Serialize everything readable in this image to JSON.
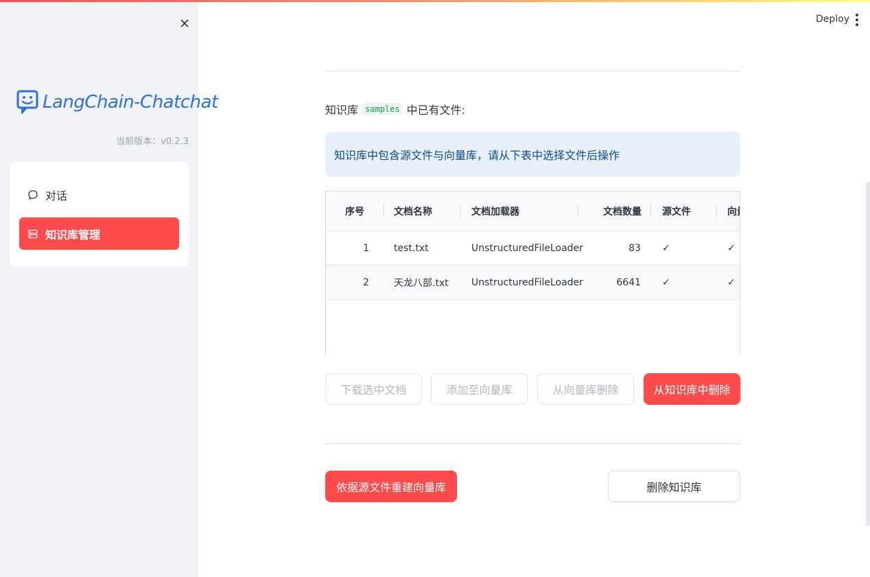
{
  "sidebar": {
    "logo_text": "LangChain-Chatchat",
    "version": "当前版本：v0.2.3",
    "nav": [
      {
        "label": "对话",
        "icon": "chat-bubble-icon",
        "active": false
      },
      {
        "label": "知识库管理",
        "icon": "database-icon",
        "active": true
      }
    ]
  },
  "header": {
    "deploy_label": "Deploy"
  },
  "main": {
    "kb_title_prefix": "知识库",
    "kb_name": "samples",
    "kb_title_suffix": "中已有文件:",
    "info_message": "知识库中包含源文件与向量库，请从下表中选择文件后操作",
    "table": {
      "columns": [
        "序号",
        "文档名称",
        "文档加载器",
        "文档数量",
        "源文件",
        "向量库"
      ],
      "rows": [
        {
          "index": "1",
          "name": "test.txt",
          "loader": "UnstructuredFileLoader",
          "count": "83",
          "source": "✓",
          "vector": "✓"
        },
        {
          "index": "2",
          "name": "天龙八部.txt",
          "loader": "UnstructuredFileLoader",
          "count": "6641",
          "source": "✓",
          "vector": "✓"
        }
      ]
    },
    "actions": {
      "download": "下载选中文档",
      "add_to_vector": "添加至向量库",
      "remove_from_vector": "从向量库删除",
      "delete_from_kb": "从知识库中删除"
    },
    "rebuild_label": "依据源文件重建向量库",
    "delete_kb_label": "删除知识库"
  },
  "colors": {
    "accent": "#ff4b4b",
    "brand_blue": "#2f6ee6",
    "info_bg": "#e8f1fb",
    "sidebar_bg": "#f0f2f6"
  }
}
